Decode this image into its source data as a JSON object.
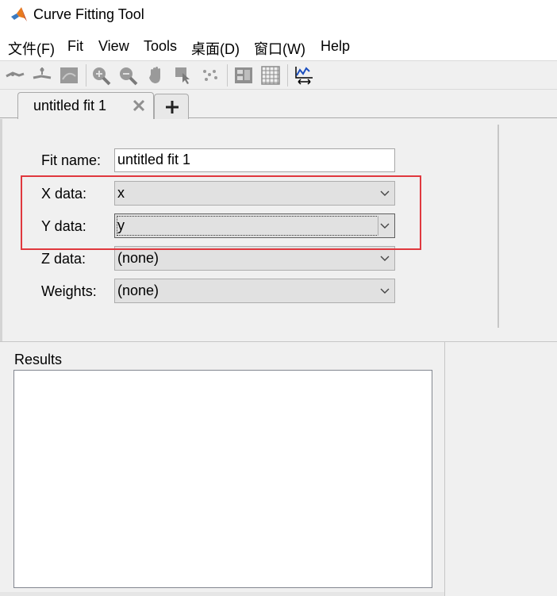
{
  "window": {
    "title": "Curve Fitting Tool"
  },
  "menu": [
    "文件(F)",
    "Fit",
    "View",
    "Tools",
    "桌面(D)",
    "窗口(W)",
    "Help"
  ],
  "toolbar": {
    "icons": [
      "fit-arrow-icon",
      "data-cursor-icon",
      "plot-region-icon",
      "zoom-in-icon",
      "zoom-out-icon",
      "pan-icon",
      "data-cursor-hand-icon",
      "exclude-outliers-icon",
      "legend-icon",
      "grid-icon",
      "axes-limits-icon"
    ]
  },
  "tabs": {
    "active_label": "untitled fit 1",
    "add_label": "+"
  },
  "form": {
    "fit_name_label": "Fit name:",
    "fit_name_value": "untitled fit 1",
    "x_label": "X data:",
    "x_value": "x",
    "y_label": "Y data:",
    "y_value": "y",
    "z_label": "Z data:",
    "z_value": "(none)",
    "weights_label": "Weights:",
    "weights_value": "(none)"
  },
  "results": {
    "label": "Results"
  },
  "colors": {
    "highlight": "#e0383e",
    "background": "#f0f0f0"
  }
}
